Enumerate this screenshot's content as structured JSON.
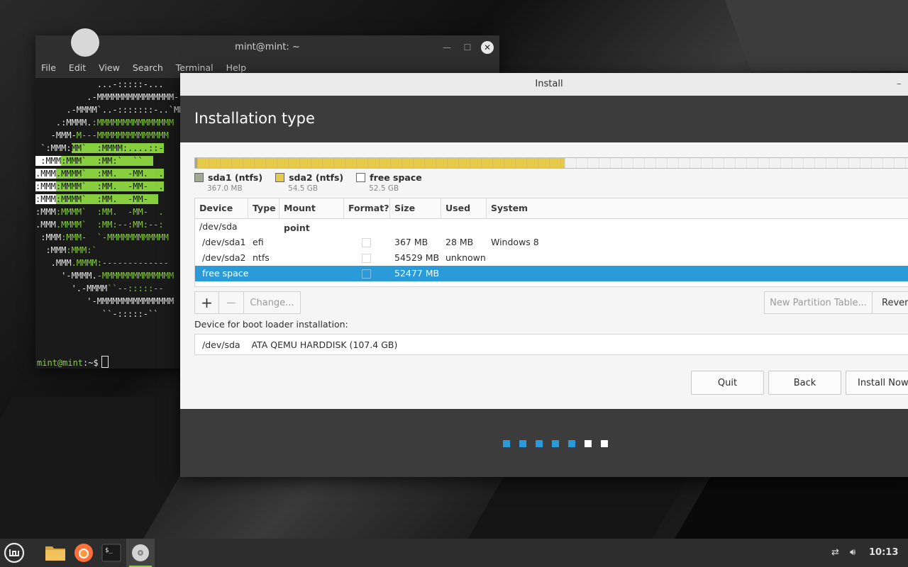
{
  "terminal": {
    "title": "mint@mint: ~",
    "menu": [
      "File",
      "Edit",
      "View",
      "Search",
      "Terminal",
      "Help"
    ],
    "prompt_user": "mint@mint",
    "prompt_rest": ":~$"
  },
  "installer": {
    "window_title": "Install",
    "heading": "Installation type",
    "legend": [
      {
        "name": "sda1 (ntfs)",
        "size": "367.0 MB",
        "color": "#a3a98f"
      },
      {
        "name": "sda2 (ntfs)",
        "size": "54.5 GB",
        "color": "#e6cb4b"
      },
      {
        "name": "free space",
        "size": "52.5 GB",
        "color": "#ffffff"
      }
    ],
    "columns": [
      "Device",
      "Type",
      "Mount point",
      "Format?",
      "Size",
      "Used",
      "System"
    ],
    "rows": [
      {
        "device": "/dev/sda",
        "type": "",
        "mount": "",
        "format": false,
        "size": "",
        "used": "",
        "system": "",
        "selected": false,
        "has_check": false
      },
      {
        "device": "/dev/sda1",
        "type": "efi",
        "mount": "",
        "format": false,
        "size": "367 MB",
        "used": "28 MB",
        "system": "Windows 8",
        "selected": false,
        "has_check": true
      },
      {
        "device": "/dev/sda2",
        "type": "ntfs",
        "mount": "",
        "format": false,
        "size": "54529 MB",
        "used": "unknown",
        "system": "",
        "selected": false,
        "has_check": true
      },
      {
        "device": "free space",
        "type": "",
        "mount": "",
        "format": false,
        "size": "52477 MB",
        "used": "",
        "system": "",
        "selected": true,
        "has_check": true
      }
    ],
    "add_label": "+",
    "remove_label": "—",
    "change_label": "Change...",
    "new_table_label": "New Partition Table...",
    "revert_label": "Revert",
    "boot_label": "Device for boot loader installation:",
    "boot_device": "/dev/sda",
    "boot_desc": "ATA QEMU HARDDISK (107.4 GB)",
    "quit_label": "Quit",
    "back_label": "Back",
    "install_label": "Install Now",
    "progress_step": 5,
    "progress_total": 7,
    "accent": "#2b9ad8"
  },
  "taskbar": {
    "apps": [
      "menu-icon",
      "files-icon",
      "firefox-icon",
      "terminal-icon",
      "installer-disc-icon"
    ],
    "clock": "10:13"
  }
}
